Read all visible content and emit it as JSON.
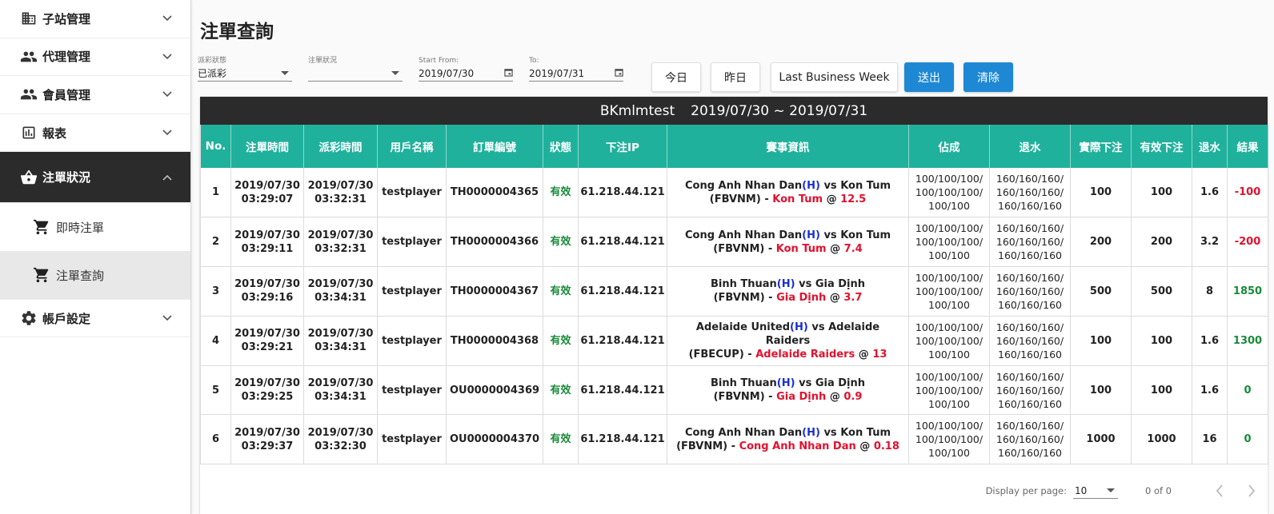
{
  "sidebar": {
    "items": [
      {
        "label": "子站管理",
        "icon": "building-icon"
      },
      {
        "label": "代理管理",
        "icon": "people-icon"
      },
      {
        "label": "會員管理",
        "icon": "people-icon"
      },
      {
        "label": "報表",
        "icon": "bar-chart-icon"
      },
      {
        "label": "注單狀況",
        "icon": "basket-icon"
      },
      {
        "label": "即時注單",
        "icon": "cart-icon"
      },
      {
        "label": "注單查詢",
        "icon": "cart-icon"
      },
      {
        "label": "帳戶設定",
        "icon": "gear-icon"
      }
    ]
  },
  "page": {
    "title": "注單查詢"
  },
  "filters": {
    "payout_status": {
      "label": "派彩狀態",
      "value": "已派彩"
    },
    "bet_status": {
      "label": "注單狀況",
      "value": ""
    },
    "start": {
      "label": "Start From:",
      "value": "2019/07/30"
    },
    "end": {
      "label": "To:",
      "value": "2019/07/31"
    }
  },
  "buttons": {
    "today": "今日",
    "yesterday": "昨日",
    "last_week": "Last Business Week",
    "submit": "送出",
    "clear": "清除"
  },
  "report": {
    "user": "BKmlmtest",
    "range": "2019/07/30 ~ 2019/07/31",
    "columns": [
      "No.",
      "注單時間",
      "派彩時間",
      "用戶名稱",
      "訂單編號",
      "狀態",
      "下注IP",
      "賽事資訊",
      "佔成",
      "退水",
      "實際下注",
      "有效下注",
      "退水",
      "結果"
    ],
    "rows": [
      {
        "no": "1",
        "bet_date": "2019/07/30",
        "bet_time": "03:29:07",
        "pay_date": "2019/07/30",
        "pay_time": "03:32:31",
        "user": "testplayer",
        "order": "TH0000004365",
        "status": "有效",
        "ip": "61.218.44.121",
        "home": "Cong Anh Nhan Dan",
        "h": "(H)",
        "vs": "vs Kon Tum",
        "league": "(FBVNM) -",
        "pick": "Kon Tum",
        "at": "@",
        "odds": "12.5",
        "share1": "100/100/100/",
        "share2": "100/100/100/",
        "share3": "100/100",
        "rebate1": "160/160/160/",
        "rebate2": "160/160/160/",
        "rebate3": "160/160/160",
        "actual": "100",
        "valid": "100",
        "rebate_amt": "1.6",
        "result": "-100",
        "result_color": "red"
      },
      {
        "no": "2",
        "bet_date": "2019/07/30",
        "bet_time": "03:29:11",
        "pay_date": "2019/07/30",
        "pay_time": "03:32:31",
        "user": "testplayer",
        "order": "TH0000004366",
        "status": "有效",
        "ip": "61.218.44.121",
        "home": "Cong Anh Nhan Dan",
        "h": "(H)",
        "vs": "vs Kon Tum",
        "league": "(FBVNM) -",
        "pick": "Kon Tum",
        "at": "@",
        "odds": "7.4",
        "share1": "100/100/100/",
        "share2": "100/100/100/",
        "share3": "100/100",
        "rebate1": "160/160/160/",
        "rebate2": "160/160/160/",
        "rebate3": "160/160/160",
        "actual": "200",
        "valid": "200",
        "rebate_amt": "3.2",
        "result": "-200",
        "result_color": "red"
      },
      {
        "no": "3",
        "bet_date": "2019/07/30",
        "bet_time": "03:29:16",
        "pay_date": "2019/07/30",
        "pay_time": "03:34:31",
        "user": "testplayer",
        "order": "TH0000004367",
        "status": "有效",
        "ip": "61.218.44.121",
        "home": "Binh Thuan",
        "h": "(H)",
        "vs": "vs Gia Dịnh",
        "league": "(FBVNM) -",
        "pick": "Gia Dịnh",
        "at": "@",
        "odds": "3.7",
        "share1": "100/100/100/",
        "share2": "100/100/100/",
        "share3": "100/100",
        "rebate1": "160/160/160/",
        "rebate2": "160/160/160/",
        "rebate3": "160/160/160",
        "actual": "500",
        "valid": "500",
        "rebate_amt": "8",
        "result": "1850",
        "result_color": "green"
      },
      {
        "no": "4",
        "bet_date": "2019/07/30",
        "bet_time": "03:29:21",
        "pay_date": "2019/07/30",
        "pay_time": "03:34:31",
        "user": "testplayer",
        "order": "TH0000004368",
        "status": "有效",
        "ip": "61.218.44.121",
        "home": "Adelaide United",
        "h": "(H)",
        "vs": "vs Adelaide Raiders",
        "league": "(FBECUP) -",
        "pick": "Adelaide Raiders",
        "at": "@",
        "odds": "13",
        "share1": "100/100/100/",
        "share2": "100/100/100/",
        "share3": "100/100",
        "rebate1": "160/160/160/",
        "rebate2": "160/160/160/",
        "rebate3": "160/160/160",
        "actual": "100",
        "valid": "100",
        "rebate_amt": "1.6",
        "result": "1300",
        "result_color": "green"
      },
      {
        "no": "5",
        "bet_date": "2019/07/30",
        "bet_time": "03:29:25",
        "pay_date": "2019/07/30",
        "pay_time": "03:34:31",
        "user": "testplayer",
        "order": "OU0000004369",
        "status": "有效",
        "ip": "61.218.44.121",
        "home": "Binh Thuan",
        "h": "(H)",
        "vs": "vs Gia Dịnh",
        "league": "(FBVNM) -",
        "pick": "Gia Dịnh",
        "at": "@",
        "odds": "0.9",
        "share1": "100/100/100/",
        "share2": "100/100/100/",
        "share3": "100/100",
        "rebate1": "160/160/160/",
        "rebate2": "160/160/160/",
        "rebate3": "160/160/160",
        "actual": "100",
        "valid": "100",
        "rebate_amt": "1.6",
        "result": "0",
        "result_color": "green"
      },
      {
        "no": "6",
        "bet_date": "2019/07/30",
        "bet_time": "03:29:37",
        "pay_date": "2019/07/30",
        "pay_time": "03:32:30",
        "user": "testplayer",
        "order": "OU0000004370",
        "status": "有效",
        "ip": "61.218.44.121",
        "home": "Cong Anh Nhan Dan",
        "h": "(H)",
        "vs": "vs Kon Tum",
        "league": "(FBVNM) -",
        "pick": "Cong Anh Nhan Dan",
        "at": "@",
        "odds": "0.18",
        "share1": "100/100/100/",
        "share2": "100/100/100/",
        "share3": "100/100",
        "rebate1": "160/160/160/",
        "rebate2": "160/160/160/",
        "rebate3": "160/160/160",
        "actual": "1000",
        "valid": "1000",
        "rebate_amt": "16",
        "result": "0",
        "result_color": "green"
      }
    ]
  },
  "pager": {
    "label": "Display per page:",
    "per_page": "10",
    "count": "0 of 0"
  },
  "colors": {
    "header_dark": "#2b2b2b",
    "table_header": "#20b19c",
    "button_blue": "#1e88d4",
    "win_green": "#1a8a3a",
    "loss_red": "#e3102d",
    "home_blue": "#1a2fd1"
  }
}
